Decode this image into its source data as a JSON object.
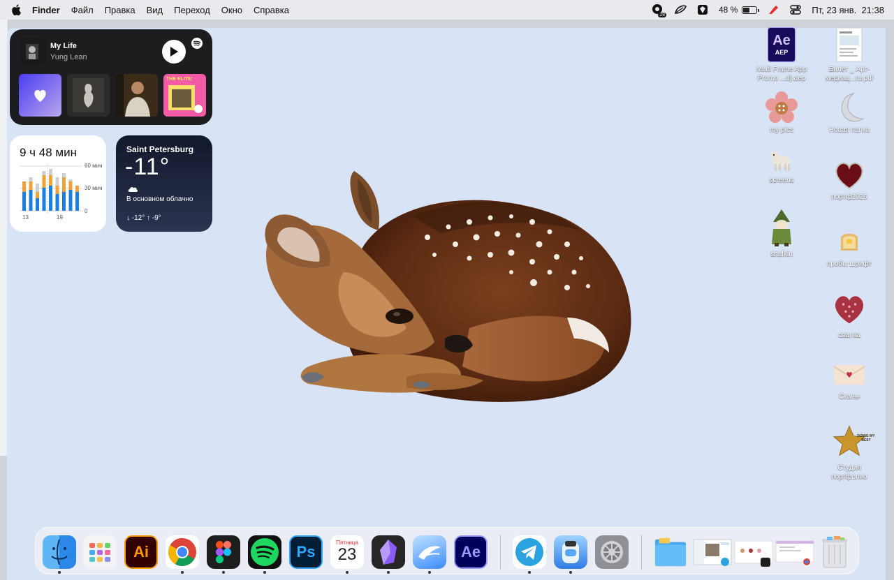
{
  "menubar": {
    "app_name": "Finder",
    "menus": [
      "Файл",
      "Правка",
      "Вид",
      "Переход",
      "Окно",
      "Справка"
    ],
    "status_badge": "28",
    "battery_percent": "48 %",
    "battery_level": 0.48,
    "datetime": "Пт, 23 янв.  21:38"
  },
  "music_widget": {
    "track": "My Life",
    "artist": "Yung Lean",
    "thumb_label": "THE ELITE:"
  },
  "screentime_widget": {
    "total": "9 ч 48 мин",
    "y_ticks": [
      "60 мин",
      "30 мин",
      "0"
    ],
    "x_ticks": [
      "13",
      "19"
    ]
  },
  "weather_widget": {
    "city": "Saint Petersburg",
    "temperature": "-11°",
    "condition": "В основном облачно",
    "range": "↓ -12° ↑ -9°"
  },
  "desktop_icons": {
    "aep": {
      "label": "Multi Frame App\nPromo ...d).aep",
      "badge": "AEP",
      "title": "Ae"
    },
    "pdf": {
      "label": "Билет _ Арт-\nмедиац...ru.pdf"
    },
    "mypics": {
      "label": "my pics"
    },
    "newfolder": {
      "label": "Новая папка"
    },
    "screens": {
      "label": "screens"
    },
    "portf": {
      "label": "портф2026"
    },
    "snufkin": {
      "label": "snufkin"
    },
    "fonts": {
      "label": "пробы шрифт"
    },
    "svalka": {
      "label": "свалка"
    },
    "scans": {
      "label": "Сканы"
    },
    "studio": {
      "label": "Студия\nпортфолио",
      "star_text": "DOING MY BEST"
    }
  },
  "dock": {
    "calendar_weekday": "Пятница",
    "calendar_day": "23",
    "ai_label": "Ai",
    "ps_label": "Ps",
    "ae_label": "Ae"
  }
}
